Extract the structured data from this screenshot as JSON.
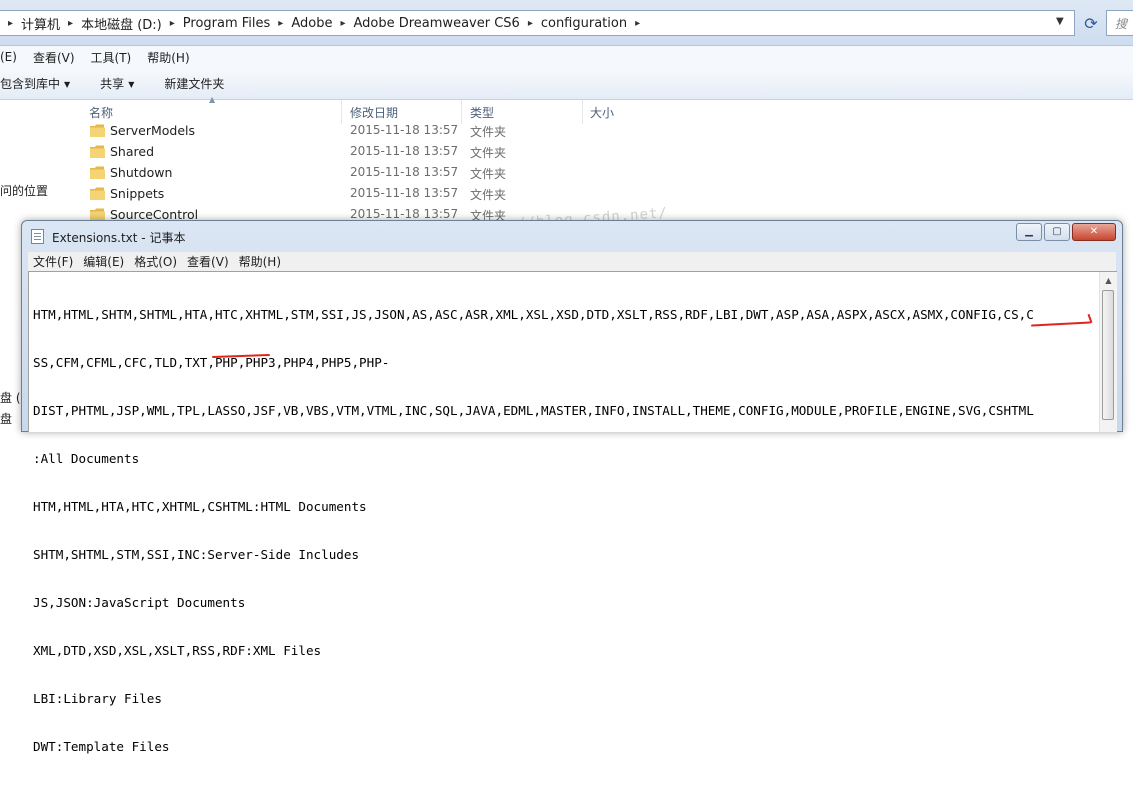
{
  "explorer": {
    "breadcrumbs": [
      "计算机",
      "本地磁盘 (D:)",
      "Program Files",
      "Adobe",
      "Adobe Dreamweaver CS6",
      "configuration"
    ],
    "search_placeholder": "搜",
    "menu": [
      "(E)",
      "查看(V)",
      "工具(T)",
      "帮助(H)"
    ],
    "toolbar": {
      "include_library": "包含到库中",
      "share": "共享",
      "new_folder": "新建文件夹"
    },
    "nav_items": [
      "问的位置",
      "盘 (",
      "盘"
    ],
    "columns": {
      "name": "名称",
      "modified": "修改日期",
      "type": "类型",
      "size": "大小"
    },
    "files": [
      {
        "name": "ServerModels",
        "date": "2015-11-18 13:57",
        "type": "文件夹"
      },
      {
        "name": "Shared",
        "date": "2015-11-18 13:57",
        "type": "文件夹"
      },
      {
        "name": "Shutdown",
        "date": "2015-11-18 13:57",
        "type": "文件夹"
      },
      {
        "name": "Snippets",
        "date": "2015-11-18 13:57",
        "type": "文件夹"
      },
      {
        "name": "SourceControl",
        "date": "2015-11-18 13:57",
        "type": "文件夹"
      }
    ],
    "watermark": "http://blog.csdn.net/"
  },
  "notepad": {
    "title": "Extensions.txt - 记事本",
    "menu": [
      "文件(F)",
      "编辑(E)",
      "格式(O)",
      "查看(V)",
      "帮助(H)"
    ],
    "lines": [
      "HTM,HTML,SHTM,SHTML,HTA,HTC,XHTML,STM,SSI,JS,JSON,AS,ASC,ASR,XML,XSL,XSD,DTD,XSLT,RSS,RDF,LBI,DWT,ASP,ASA,ASPX,ASCX,ASMX,CONFIG,CS,C",
      "SS,CFM,CFML,CFC,TLD,TXT,PHP,PHP3,PHP4,PHP5,PHP-",
      "DIST,PHTML,JSP,WML,TPL,LASSO,JSF,VB,VBS,VTM,VTML,INC,SQL,JAVA,EDML,MASTER,INFO,INSTALL,THEME,CONFIG,MODULE,PROFILE,ENGINE,SVG,CSHTML",
      ":All Documents",
      "HTM,HTML,HTA,HTC,XHTML,CSHTML:HTML Documents",
      "SHTM,SHTML,STM,SSI,INC:Server-Side Includes",
      "JS,JSON:JavaScript Documents",
      "XML,DTD,XSD,XSL,XSLT,RSS,RDF:XML Files",
      "LBI:Library Files",
      "DWT:Template Files"
    ]
  }
}
